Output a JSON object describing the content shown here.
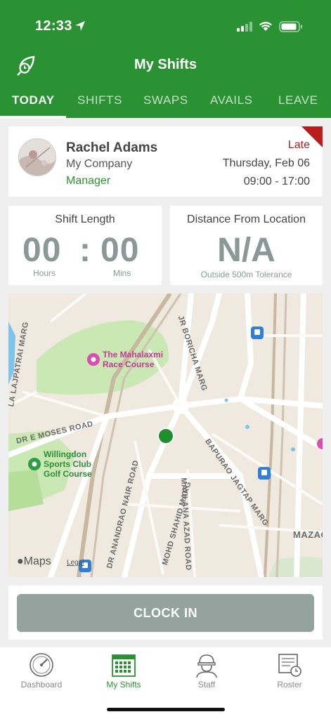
{
  "status_bar": {
    "time": "12:33"
  },
  "header": {
    "title": "My Shifts"
  },
  "tabs": [
    {
      "label": "TODAY",
      "active": true
    },
    {
      "label": "SHIFTS",
      "active": false
    },
    {
      "label": "SWAPS",
      "active": false
    },
    {
      "label": "AVAILS",
      "active": false
    },
    {
      "label": "LEAVE",
      "active": false
    }
  ],
  "profile": {
    "name": "Rachel Adams",
    "company": "My Company",
    "role": "Manager",
    "status": "Late",
    "date": "Thursday, Feb 06",
    "hours": "09:00 - 17:00"
  },
  "shift_length": {
    "label": "Shift Length",
    "hours": "00",
    "separator": ":",
    "mins": "00",
    "hours_label": "Hours",
    "mins_label": "Mins"
  },
  "distance": {
    "label": "Distance From Location",
    "value": "N/A",
    "note": "Outside 500m Tolerance"
  },
  "map": {
    "places": {
      "race_course": "The Mahalaxmi\nRace Course",
      "golf": "Willingdon\nSports Club\nGolf Course"
    },
    "roads": {
      "boricha": "JR BORICHA MARG",
      "lajpatrai": "LA LAJPATRAI MARG",
      "moses": "DR E MOSES ROAD",
      "anandrao": "DR ANANDRAO NAIR ROAD",
      "shahid": "MOHD SHAHID MARG",
      "azad": "MAULANA AZAD ROAD",
      "bapurao": "BAPURAO JAGTAP MARG",
      "mazag": "MAZAG"
    },
    "brand": "Maps",
    "legal": "Legal"
  },
  "action": {
    "clock_in": "CLOCK IN"
  },
  "bottom_nav": [
    {
      "label": "Dashboard",
      "icon": "gauge-icon",
      "active": false
    },
    {
      "label": "My Shifts",
      "icon": "calendar-icon",
      "active": true
    },
    {
      "label": "Staff",
      "icon": "worker-helmet-icon",
      "active": false
    },
    {
      "label": "Roster",
      "icon": "roster-clock-icon",
      "active": false
    }
  ],
  "colors": {
    "brand": "#2a9232",
    "late": "#b02020",
    "muted": "#8a9995",
    "button": "#94a39e"
  }
}
